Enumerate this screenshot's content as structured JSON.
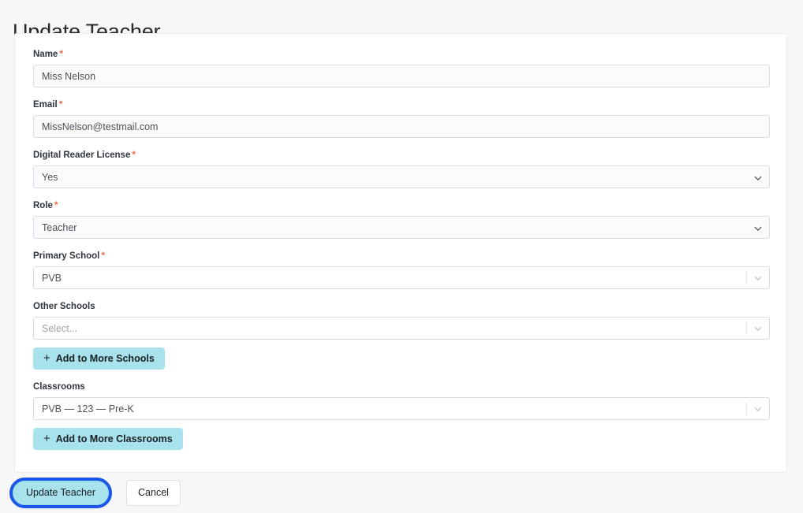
{
  "page": {
    "title": "Update Teacher"
  },
  "form": {
    "fields": [
      {
        "label": "Name",
        "required_mark": "*",
        "type": "text",
        "value": "Miss Nelson"
      },
      {
        "label": "Email",
        "required_mark": "*",
        "type": "text",
        "value": "MissNelson@testmail.com"
      },
      {
        "label": "Digital Reader License",
        "required_mark": "*",
        "type": "select",
        "value": "Yes"
      },
      {
        "label": "Role",
        "required_mark": "*",
        "type": "select",
        "value": "Teacher"
      },
      {
        "label": "Primary School",
        "required_mark": "*",
        "type": "react-select",
        "value": "PVB"
      },
      {
        "label": "Other Schools",
        "required_mark": "",
        "type": "react-select",
        "value": "",
        "placeholder": "Select..."
      },
      {
        "label": "Classrooms",
        "required_mark": "",
        "type": "react-select",
        "value": "PVB — 123 — Pre-K"
      }
    ],
    "add_schools_button": "Add to More Schools",
    "add_classrooms_button": "Add to More Classrooms",
    "plus_glyph": "+"
  },
  "footer": {
    "submit_label": "Update Teacher",
    "cancel_label": "Cancel"
  },
  "colors": {
    "page_background": "#f7f7f8",
    "card_background": "#ffffff",
    "accent_button": "#a8e2ec",
    "focus_ring": "#1a56e8",
    "required_asterisk": "#f2693c",
    "input_border": "#d7dde3"
  }
}
